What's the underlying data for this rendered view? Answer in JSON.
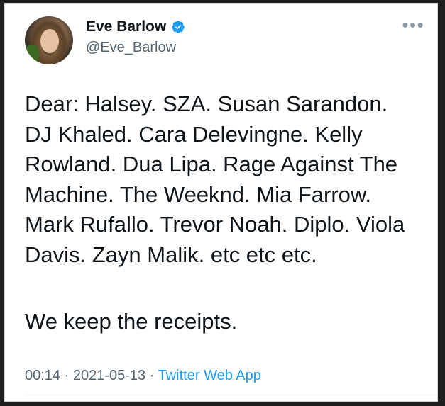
{
  "author": {
    "display_name": "Eve Barlow",
    "handle": "@Eve_Barlow",
    "verified": true
  },
  "tweet": {
    "text": "Dear: Halsey. SZA. Susan Sarandon.\nDJ Khaled. Cara Delevingne. Kelly\nRowland. Dua Lipa. Rage Against The\nMachine. The Weeknd. Mia Farrow.\nMark Rufallo. Trevor Noah. Diplo. Viola\nDavis. Zayn Malik. etc etc etc.",
    "text_second": "We keep the receipts."
  },
  "meta": {
    "time": "00:14",
    "separator": "·",
    "date": "2021-05-13",
    "app": "Twitter Web App"
  },
  "icons": {
    "more": "more-options-icon",
    "verified": "verified-badge-icon"
  },
  "colors": {
    "accent": "#1d9bf0",
    "text": "#0f1419",
    "secondary": "#536471"
  }
}
